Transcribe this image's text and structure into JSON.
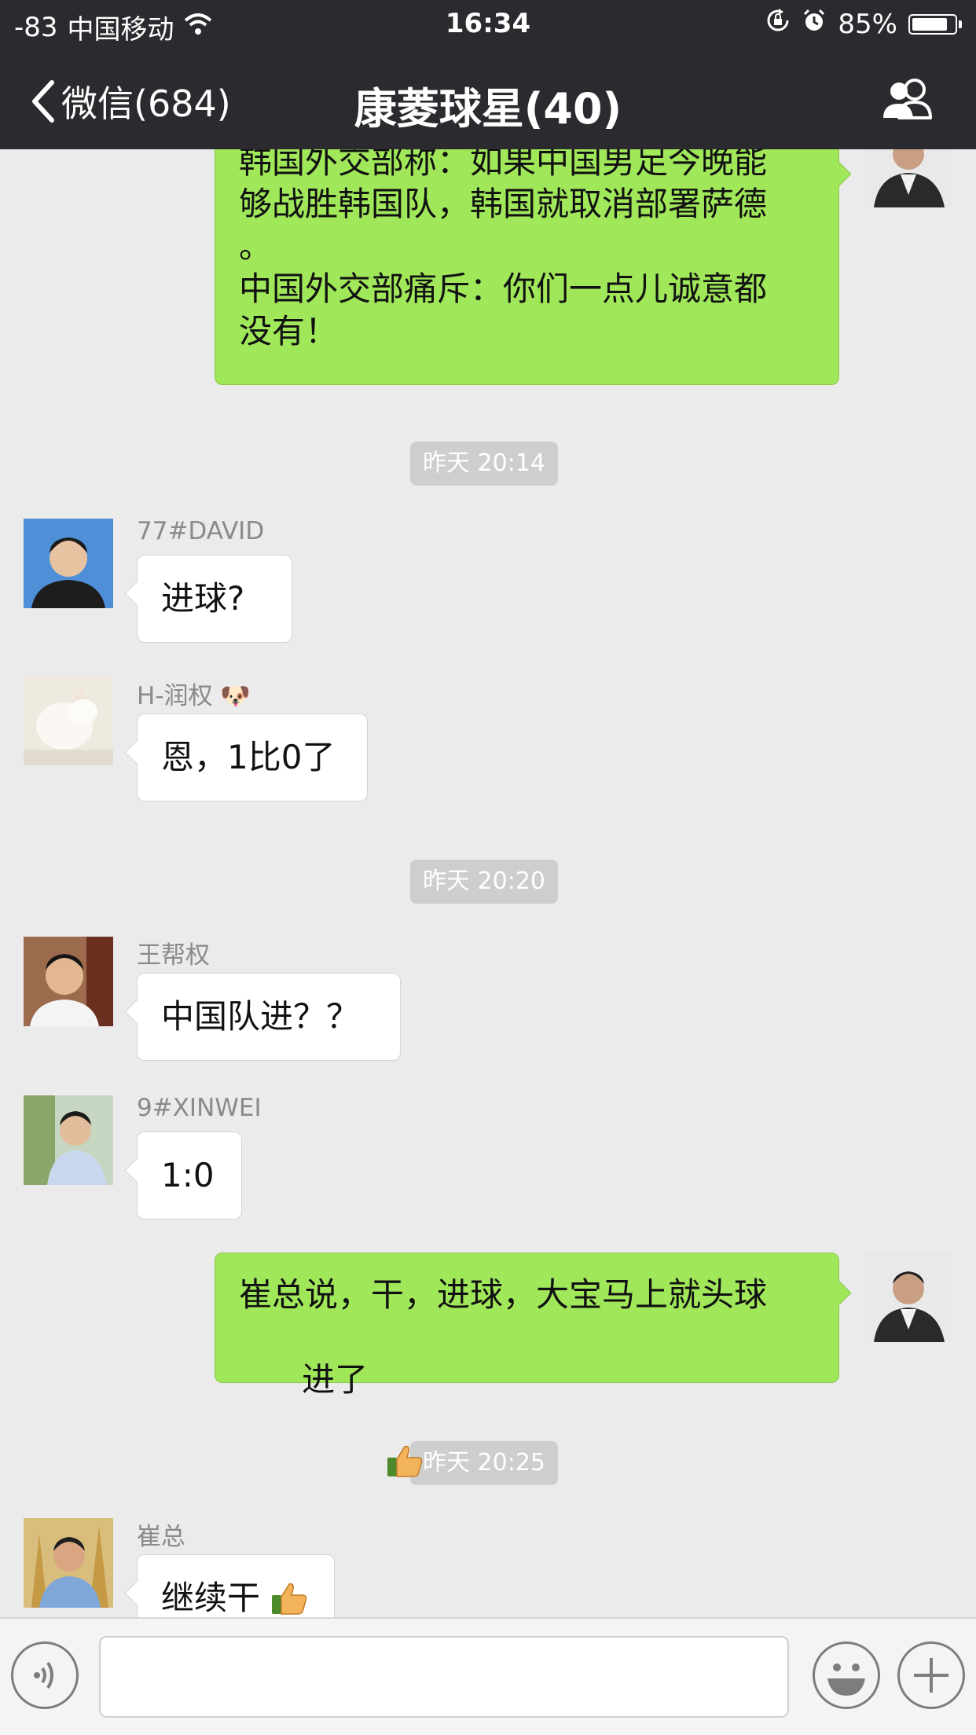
{
  "status_bar": {
    "signal": "-83",
    "carrier": "中国移动",
    "time": "16:34",
    "battery_percent": "85%",
    "battery_level": 0.85
  },
  "nav": {
    "back_label": "微信(684)",
    "title": "康菱球星(40)"
  },
  "messages": {
    "m1": {
      "direction": "outgoing",
      "text": "韩国外交部称：如果中国男足今晚能\n够战胜韩国队，韩国就取消部署萨德\n。\n中国外交部痛斥：你们一点儿诚意都\n没有！"
    },
    "ts1": "昨天 20:14",
    "m2": {
      "sender": "77#DAVID",
      "text": "进球?"
    },
    "m3": {
      "sender": "H-润权",
      "sender_emoji": "🐶",
      "text": "恩，1比0了"
    },
    "ts2": "昨天 20:20",
    "m4": {
      "sender": "王帮权",
      "text": "中国队进？？"
    },
    "m5": {
      "sender": "9#XINWEI",
      "text": "1:0"
    },
    "m6": {
      "direction": "outgoing",
      "text_line1": "崔总说，干，进球，大宝马上就头球",
      "text_line2": "进了",
      "emoji": "thumbs-up"
    },
    "ts3": "昨天 20:25",
    "m7": {
      "sender": "崔总",
      "text": "继续干",
      "emoji": "thumbs-up"
    }
  },
  "colors": {
    "nav_background": "#2b2a2f",
    "chat_background": "#ebebeb",
    "outgoing_bubble": "#a0e75a",
    "incoming_bubble": "#ffffff",
    "timestamp_pill": "#cecece"
  },
  "icons": {
    "back": "chevron-left-icon",
    "members": "group-members-icon",
    "voice": "voice-icon",
    "emoji": "emoji-icon",
    "more": "plus-icon"
  }
}
